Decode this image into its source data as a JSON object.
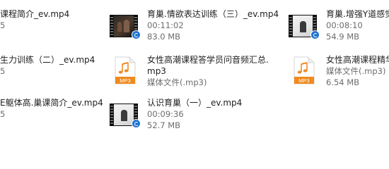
{
  "files": [
    {
      "id": "f1",
      "name": "课程简介_ev.mp4",
      "detail": "5",
      "size": "",
      "icon": "video-thumbnail"
    },
    {
      "id": "f2",
      "name": "育巢.情欲表达训练（三）_ev.mp4",
      "detail": "00:11:02",
      "size": "83.0 MB",
      "icon": "video-thumbnail"
    },
    {
      "id": "f3",
      "name": "育巢.增强Y道感觉",
      "detail": "00:08:10",
      "size": "54.9 MB",
      "icon": "video-thumbnail"
    },
    {
      "id": "f4",
      "name": "生力训练（二）_ev.mp4",
      "detail": "5",
      "size": "",
      "icon": "video-thumbnail"
    },
    {
      "id": "f5",
      "name": "女性高潮课程答学员问音频汇总.",
      "name2": "mp3",
      "detail": "媒体文件(.mp3)",
      "size": "",
      "icon": "mp3-file-icon",
      "icon_label": "MP3"
    },
    {
      "id": "f6",
      "name": "女性高潮课程精华",
      "detail": "媒体文件(.mp3)",
      "size": "6.54 MB",
      "icon": "mp3-file-icon",
      "icon_label": "MP3"
    },
    {
      "id": "f7",
      "name": "E躯体高.巢课简介_ev.mp4",
      "detail": "5",
      "size": "",
      "icon": "video-thumbnail"
    },
    {
      "id": "f8",
      "name": "认识育巢（一）_ev.mp4",
      "detail": "00:09:36",
      "size": "52.7 MB",
      "icon": "video-thumbnail"
    }
  ],
  "colors": {
    "mp3_orange": "#f08a1f",
    "name_text": "#1e1e1e",
    "detail_text": "#6d6d6d"
  }
}
